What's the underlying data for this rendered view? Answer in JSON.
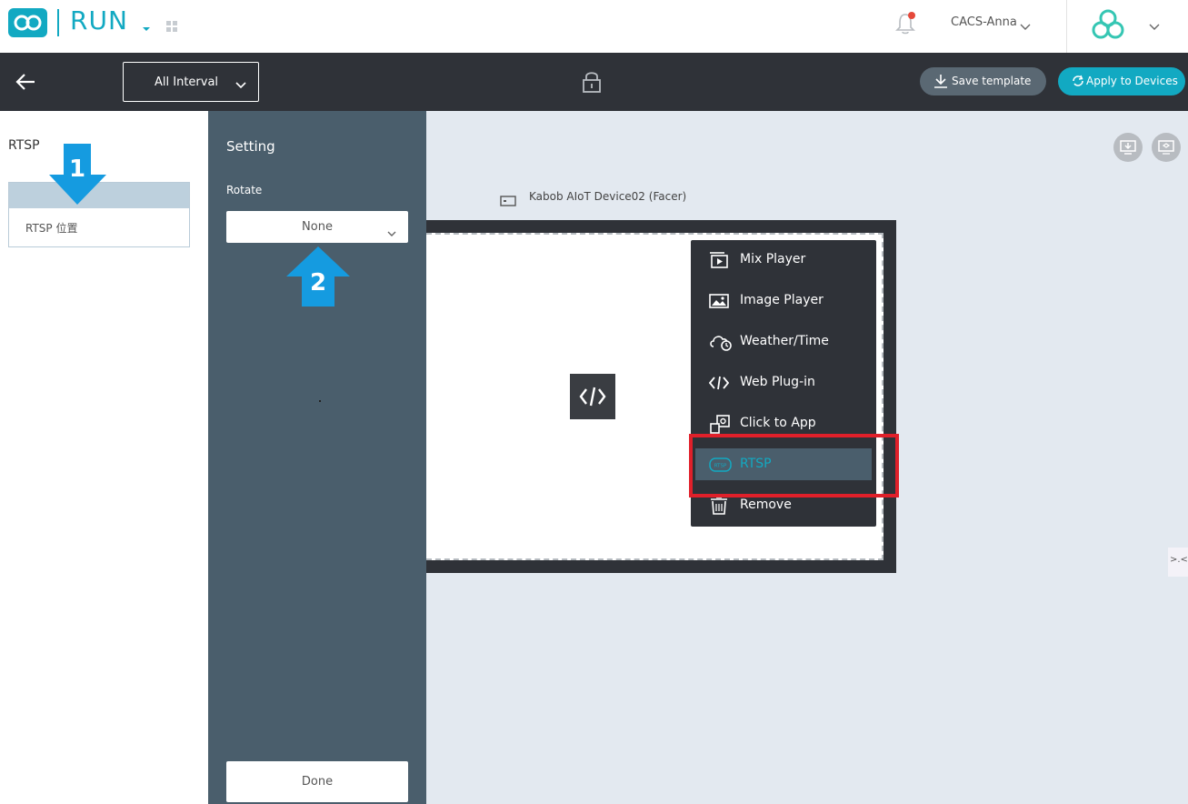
{
  "app": {
    "name": "RUN",
    "user": "CACS-Anna"
  },
  "toolbar": {
    "interval": "All Interval",
    "save_label": "Save template",
    "apply_label": "Apply to Devices"
  },
  "left_panel": {
    "title": "RTSP",
    "card_label": "RTSP 位置"
  },
  "setting": {
    "title": "Setting",
    "rotate_label": "Rotate",
    "rotate_value": "None",
    "done_label": "Done"
  },
  "canvas": {
    "device_name": "Kabob AIoT Device02 (Facer)",
    "side_toggle": ">.<"
  },
  "context_menu": {
    "items": [
      {
        "label": "Mix Player",
        "icon": "mix-player-icon"
      },
      {
        "label": "Image Player",
        "icon": "image-player-icon"
      },
      {
        "label": "Weather/Time",
        "icon": "weather-icon"
      },
      {
        "label": "Web Plug-in",
        "icon": "code-icon"
      },
      {
        "label": "Click to App",
        "icon": "click-to-app-icon"
      },
      {
        "label": "RTSP",
        "icon": "rtsp-icon",
        "active": true
      },
      {
        "label": "Remove",
        "icon": "trash-icon"
      }
    ]
  },
  "annotations": {
    "step1": "1",
    "step2": "2"
  },
  "colors": {
    "accent": "#12a9c2",
    "toolbar": "#2f3238",
    "panel": "#4a5e6c",
    "highlight": "#e0202a"
  }
}
